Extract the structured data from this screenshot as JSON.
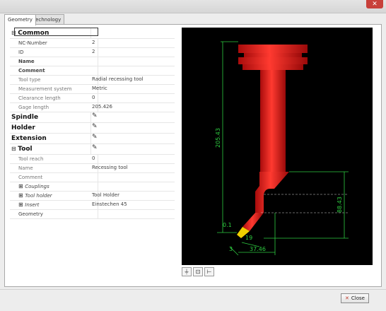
{
  "tabs": [
    "Geometry",
    "Technology"
  ],
  "properties": [
    {
      "type": "cat",
      "expand": "⊟",
      "label": "Common",
      "selected": true
    },
    {
      "type": "sub",
      "label": "NC-Number",
      "value": "2"
    },
    {
      "type": "sub",
      "label": "ID",
      "value": "2"
    },
    {
      "type": "sub",
      "label": "Name",
      "value": ""
    },
    {
      "type": "sub",
      "label": "Comment",
      "value": ""
    },
    {
      "type": "sub",
      "grey": true,
      "label": "Tool type",
      "value": "Radial recessing tool"
    },
    {
      "type": "sub",
      "grey": true,
      "label": "Measurement system",
      "value": "Metric"
    },
    {
      "type": "sub",
      "grey": true,
      "label": "Clearance length",
      "value": "0"
    },
    {
      "type": "sub",
      "grey": true,
      "label": "Gage length",
      "value": "205.426"
    },
    {
      "type": "cat",
      "label": "Spindle",
      "edit": true
    },
    {
      "type": "cat",
      "label": "Holder",
      "edit": true
    },
    {
      "type": "cat",
      "label": "Extension",
      "edit": true
    },
    {
      "type": "cat",
      "expand": "⊟",
      "label": "Tool",
      "edit": true
    },
    {
      "type": "sub",
      "grey": true,
      "label": "Tool reach",
      "value": "0"
    },
    {
      "type": "sub",
      "grey": true,
      "label": "Name",
      "value": "Recessing tool"
    },
    {
      "type": "sub",
      "grey": true,
      "label": "Comment",
      "value": ""
    },
    {
      "type": "sub",
      "expand": "⊞",
      "italic": true,
      "label": "Couplings",
      "value": ""
    },
    {
      "type": "sub",
      "expand": "⊞",
      "italic": true,
      "label": "Tool holder",
      "value": "Tool Holder"
    },
    {
      "type": "sub",
      "expand": "⊞",
      "italic": true,
      "label": "Insert",
      "value": "Einstechen 45"
    },
    {
      "type": "sub",
      "label": "Geometry",
      "value": ""
    }
  ],
  "drawing": {
    "dim_gage": "205.43",
    "dim_reach": "88.43",
    "dim_width": "37.46",
    "dim_offset": "19",
    "dim_radius": "0.1",
    "dim_angle": "3",
    "colors": {
      "tool": "#e0201e",
      "insert": "#f0d000",
      "dim": "#2ecc40"
    }
  },
  "viewer_tools": [
    "filter-icon",
    "fit-view-icon",
    "measure-icon"
  ],
  "close_label": "Close"
}
